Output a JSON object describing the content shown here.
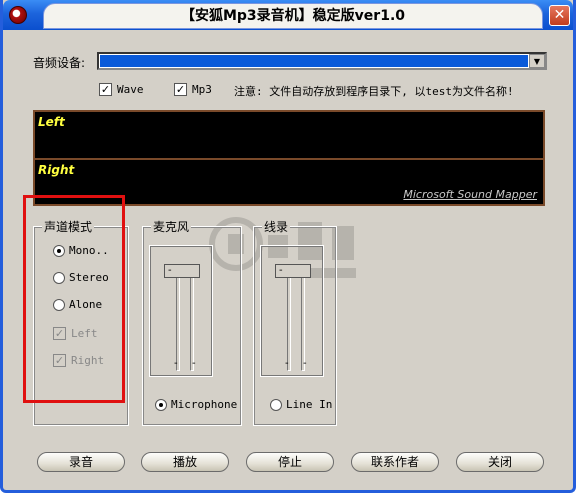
{
  "window": {
    "title": "【安狐Mp3录音机】稳定版ver1.0",
    "close_glyph": "✕"
  },
  "audio_device": {
    "label": "音频设备:"
  },
  "formats": {
    "wave_label": "Wave",
    "wave_checked": true,
    "mp3_label": "Mp3",
    "mp3_checked": true,
    "note": "注意: 文件自动存放到程序目录下, 以test为文件名称!"
  },
  "meter": {
    "left_label": "Left",
    "right_label": "Right",
    "device_name": "Microsoft Sound Mapper"
  },
  "channel_mode": {
    "title": "声道模式",
    "options": [
      {
        "label": "Mono..",
        "selected": true,
        "enabled": true
      },
      {
        "label": "Stereo",
        "selected": false,
        "enabled": true
      },
      {
        "label": "Alone",
        "selected": false,
        "enabled": true
      }
    ],
    "left_label": "Left",
    "left_checked": true,
    "right_label": "Right",
    "right_checked": true
  },
  "microphone": {
    "title": "麦克风",
    "radio_label": "Microphone",
    "selected": true,
    "tick": "-"
  },
  "line_in": {
    "title": "线录",
    "radio_label": "Line In",
    "selected": false,
    "tick": "-"
  },
  "buttons": {
    "record": "录音",
    "play": "播放",
    "stop": "停止",
    "contact": "联系作者",
    "close": "关闭"
  },
  "colors": {
    "titlebar": "#0b4fce",
    "meter_bg": "#000000",
    "meter_label": "#ffff40",
    "highlight_box": "#e01010"
  }
}
